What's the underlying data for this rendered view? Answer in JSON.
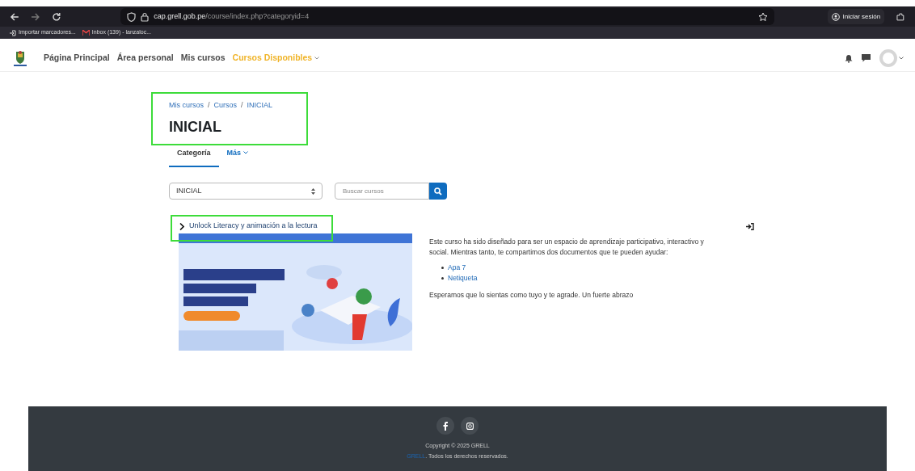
{
  "browser": {
    "url_host": "cap.grell.gob.pe",
    "url_path": "/course/index.php?categoryid=4",
    "bookmarks": [
      {
        "label": "Importar marcadores..."
      },
      {
        "label": "Inbox (139) - lanzaloc..."
      }
    ],
    "sign_in": "Iniciar sesión"
  },
  "navbar": {
    "items": [
      {
        "label": "Página Principal",
        "selected": false,
        "dropdown": false
      },
      {
        "label": "Área personal",
        "selected": false,
        "dropdown": false
      },
      {
        "label": "Mis cursos",
        "selected": false,
        "dropdown": false
      },
      {
        "label": "Cursos Disponibles",
        "selected": true,
        "dropdown": true
      }
    ]
  },
  "breadcrumb": [
    {
      "kind": "link",
      "text": "Mis cursos"
    },
    {
      "kind": "separator",
      "text": "/"
    },
    {
      "kind": "link",
      "text": "Cursos"
    },
    {
      "kind": "separator",
      "text": "/"
    },
    {
      "kind": "link",
      "text": "INICIAL"
    }
  ],
  "title": "INICIAL",
  "tabs": [
    {
      "label": "Categoría",
      "selected": true,
      "dropdown": false
    },
    {
      "label": "Más",
      "selected": false,
      "dropdown": true
    }
  ],
  "category_select": {
    "value": "INICIAL"
  },
  "search": {
    "placeholder": "Buscar cursos"
  },
  "course": {
    "name": "Unlock Literacy y animación a la lectura",
    "expanded": false,
    "description": "Este curso ha sido diseñado para ser un espacio de aprendizaje participativo, interactivo y social. Mientras tanto, te compartimos dos documentos que te pueden ayudar:",
    "links": [
      "Apa 7",
      "Netiqueta"
    ],
    "closing": "Esperamos que lo sientas como tuyo y te agrade. Un fuerte abrazo"
  },
  "footer": {
    "copyright": "Copyright © 2025 GRELL",
    "link": "GRELL",
    "rights": ". Todos los derechos reservados."
  }
}
